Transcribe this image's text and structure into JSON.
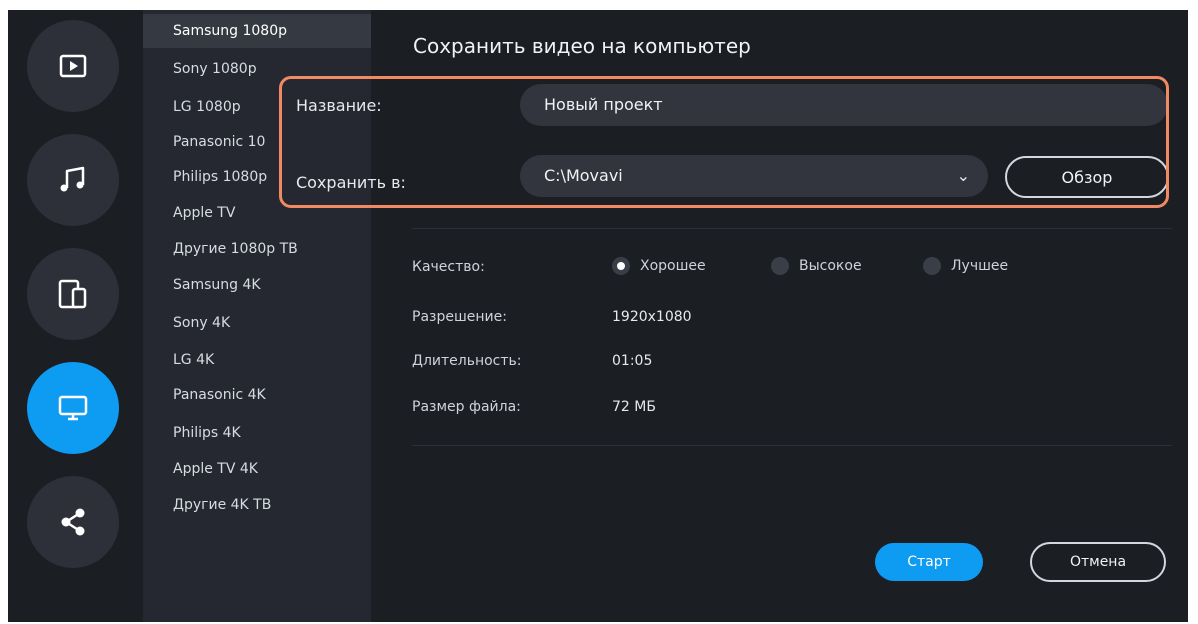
{
  "sidebar": {
    "items": [
      {
        "icon": "play-icon",
        "active": false
      },
      {
        "icon": "music-icon",
        "active": false
      },
      {
        "icon": "devices-icon",
        "active": false
      },
      {
        "icon": "monitor-icon",
        "active": true
      },
      {
        "icon": "share-icon",
        "active": false
      }
    ]
  },
  "presets": {
    "items": [
      {
        "label": "Samsung 1080p",
        "active": true
      },
      {
        "label": "Sony 1080p"
      },
      {
        "label": "LG 1080p"
      },
      {
        "label": "Panasonic 10"
      },
      {
        "label": "Philips 1080p"
      },
      {
        "label": "Apple TV"
      },
      {
        "label": "Другие 1080p ТВ"
      },
      {
        "label": "Samsung 4K"
      },
      {
        "label": "Sony 4K"
      },
      {
        "label": "LG 4K"
      },
      {
        "label": "Panasonic 4K"
      },
      {
        "label": "Philips 4K"
      },
      {
        "label": "Apple TV 4K"
      },
      {
        "label": "Другие 4K ТВ"
      }
    ]
  },
  "dialog": {
    "title": "Сохранить видео на компьютер",
    "name_label": "Название:",
    "name_value": "Новый проект",
    "save_to_label": "Сохранить в:",
    "save_to_value": "C:\\Movavi",
    "browse_label": "Обзор"
  },
  "settings": {
    "quality_label": "Качество:",
    "quality_options": [
      {
        "label": "Хорошее",
        "selected": true
      },
      {
        "label": "Высокое",
        "selected": false
      },
      {
        "label": "Лучшее",
        "selected": false
      }
    ],
    "resolution_label": "Разрешение:",
    "resolution_value": "1920x1080",
    "duration_label": "Длительность:",
    "duration_value": "01:05",
    "filesize_label": "Размер файла:",
    "filesize_value": "72 МБ"
  },
  "actions": {
    "start_label": "Старт",
    "cancel_label": "Отмена"
  },
  "colors": {
    "accent": "#0e9bf2",
    "highlight": "#f08a62",
    "background": "#1b1e23",
    "panel": "#252830"
  }
}
